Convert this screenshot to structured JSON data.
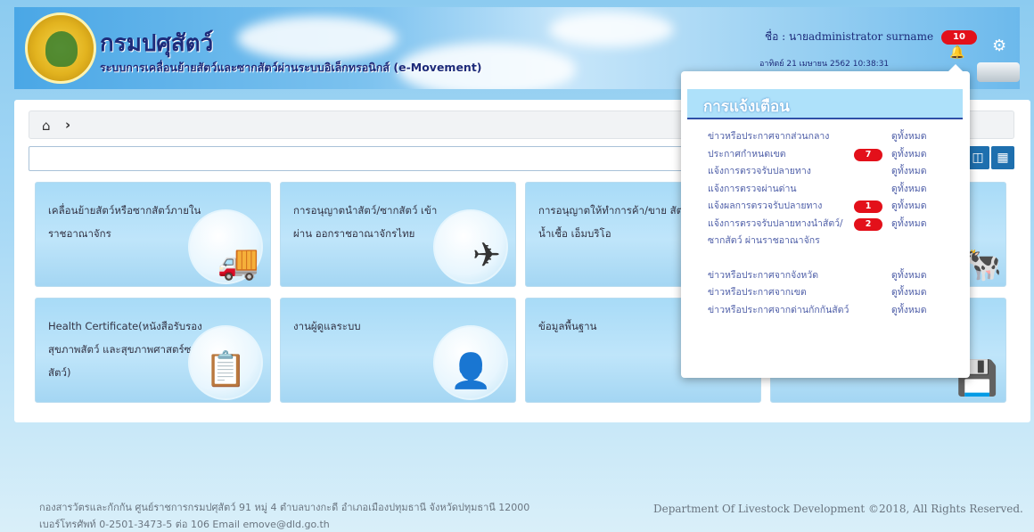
{
  "header": {
    "dept_name": "กรมปศุสัตว์",
    "system_name": "ระบบการเคลื่อนย้ายสัตว์และซากสัตว์ผ่านระบบอิเล็กทรอนิกส์ (e-Movement)",
    "user_label": "ชื่อ : นายadministrator surname",
    "datetime": "อาทิตย์ 21 เมษายน 2562 10:38:31",
    "notification_count": "10"
  },
  "icons": {
    "bell": "bell-icon",
    "gear": "gear-icon",
    "home": "home-icon"
  },
  "cards": [
    {
      "label": "เคลื่อนย้ายสัตว์หรือซากสัตว์ภายในราชอาณาจักร",
      "icon": "truck-icon"
    },
    {
      "label": "การอนุญาตนำสัตว์/ซากสัตว์ เข้า ผ่าน ออกราชอาณาจักรไทย",
      "icon": "airplane-icon"
    },
    {
      "label": "การอนุญาตให้ทำการค้า/ขาย สัตว์ น้ำเชื้อ เอ็มบริโอ",
      "icon": "animal-icon"
    },
    {
      "label": "",
      "icon": "cow-icon"
    },
    {
      "label": "Health Certificate(หนังสือรับรองสุขภาพสัตว์ และสุขภาพศาสตร์ซากสัตว์)",
      "icon": "document-icon"
    },
    {
      "label": "งานผู้ดูแลระบบ",
      "icon": "admin-user-icon"
    },
    {
      "label": "ข้อมูลพื้นฐาน",
      "icon": "database-icon"
    },
    {
      "label": "",
      "icon": "usb-drive-icon"
    }
  ],
  "notifications": {
    "title": "การแจ้งเตือน",
    "items": [
      {
        "text": "ข่าวหรือประกาศจากส่วนกลาง",
        "count": "",
        "link": "ดูทั้งหมด"
      },
      {
        "text": "ประกาศกำหนดเขต",
        "count": "7",
        "link": "ดูทั้งหมด"
      },
      {
        "text": "แจ้งการตรวจรับปลายทาง",
        "count": "",
        "link": "ดูทั้งหมด"
      },
      {
        "text": "แจ้งการตรวจผ่านด่าน",
        "count": "",
        "link": "ดูทั้งหมด"
      },
      {
        "text": "แจ้งผลการตรวจรับปลายทาง",
        "count": "1",
        "link": "ดูทั้งหมด"
      },
      {
        "text": "แจ้งการตรวจรับปลายทางนำสัตว์/ซากสัตว์ ผ่านราชอาณาจักร",
        "count": "2",
        "link": "ดูทั้งหมด"
      },
      {
        "text": "ข่าวหรือประกาศจากจังหวัด",
        "count": "",
        "link": "ดูทั้งหมด"
      },
      {
        "text": "ข่าวหรือประกาศจากเขต",
        "count": "",
        "link": "ดูทั้งหมด"
      },
      {
        "text": "ข่าวหรือประกาศจากด่านกักกันสัตว์",
        "count": "",
        "link": "ดูทั้งหมด"
      }
    ]
  },
  "footer": {
    "address_line1": "กองสารวัตรและกักกัน ศูนย์ราชการกรมปศุสัตว์ 91 หมู่ 4 ตำบลบางกะดี อำเภอเมืองปทุมธานี จังหวัดปทุมธานี 12000",
    "address_line2": "เบอร์โทรศัพท์ 0-2501-3473-5 ต่อ 106 Email emove@dld.go.th",
    "copyright": "Department Of Livestock Development ©2018, All Rights Reserved."
  },
  "colors": {
    "accent": "#1e6fae",
    "badge": "#e3101a",
    "title": "#1d2b7a"
  }
}
